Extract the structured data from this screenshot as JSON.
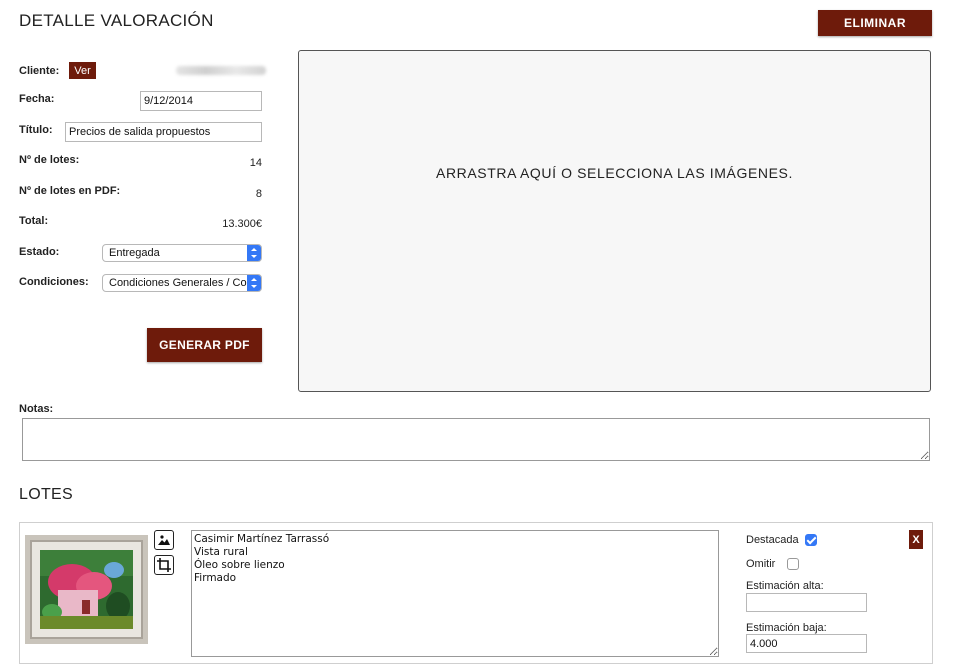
{
  "header": {
    "title": "DETALLE VALORACIÓN",
    "delete_label": "ELIMINAR"
  },
  "colors": {
    "accent": "#6e1b0b",
    "checkbox": "#3478f6"
  },
  "details": {
    "client_label": "Cliente:",
    "client_view_label": "Ver",
    "date_label": "Fecha:",
    "date_value": "9/12/2014",
    "title_label": "Título:",
    "title_value": "Precios de salida propuestos",
    "lots_label": "Nº de lotes:",
    "lots_value": "14",
    "lots_pdf_label": "Nº de lotes en PDF:",
    "lots_pdf_value": "8",
    "total_label": "Total:",
    "total_value": "13.300€",
    "status_label": "Estado:",
    "status_value": "Entregada",
    "conditions_label": "Condiciones:",
    "conditions_value": "Condiciones Generales / Co",
    "generate_pdf_label": "GENERAR PDF"
  },
  "dropzone": {
    "text": "ARRASTRA AQUÍ O SELECCIONA LAS IMÁGENES."
  },
  "notes": {
    "label": "Notas:",
    "value": ""
  },
  "lots": {
    "title": "LOTES",
    "items": [
      {
        "description": "Casimir Martínez Tarrassó\nVista rural\nÓleo sobre lienzo\nFirmado",
        "featured_label": "Destacada",
        "featured": true,
        "omit_label": "Omitir",
        "omit": false,
        "estimate_high_label": "Estimación alta:",
        "estimate_high_value": "",
        "estimate_low_label": "Estimación baja:",
        "estimate_low_value": "4.000",
        "remove_label": "X"
      }
    ]
  }
}
